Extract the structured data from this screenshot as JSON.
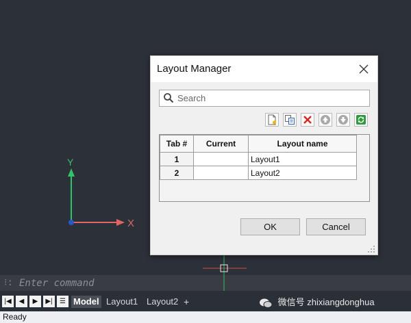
{
  "dialog": {
    "title": "Layout Manager",
    "search": {
      "placeholder": "Search",
      "value": ""
    },
    "toolbar": {
      "buttons": [
        {
          "icon": "new-layout-icon"
        },
        {
          "icon": "copy-layout-icon"
        },
        {
          "icon": "delete-icon"
        },
        {
          "icon": "move-up-icon"
        },
        {
          "icon": "move-down-icon"
        },
        {
          "icon": "refresh-icon"
        }
      ]
    },
    "table": {
      "columns": [
        "Tab #",
        "Current",
        "Layout name"
      ],
      "rows": [
        {
          "tab": "1",
          "current": "",
          "name": "Layout1"
        },
        {
          "tab": "2",
          "current": "",
          "name": "Layout2"
        }
      ]
    },
    "ok_label": "OK",
    "cancel_label": "Cancel"
  },
  "ucs": {
    "x_label": "X",
    "y_label": "Y"
  },
  "command_line": {
    "grip": "⁝:",
    "placeholder": "Enter command"
  },
  "layout_tabs": {
    "nav": [
      "|◀",
      "◀",
      "▶",
      "▶|",
      "☰"
    ],
    "tabs": [
      {
        "label": "Model",
        "active": true
      },
      {
        "label": "Layout1",
        "active": false
      },
      {
        "label": "Layout2",
        "active": false
      }
    ],
    "add_label": "+"
  },
  "watermark": "微信号 zhixiangdonghua",
  "status": "Ready",
  "colors": {
    "canvas": "#2c3038",
    "x_axis": "#e06666",
    "y_axis": "#32c36a",
    "dialog_bg": "#f0f0f0"
  }
}
